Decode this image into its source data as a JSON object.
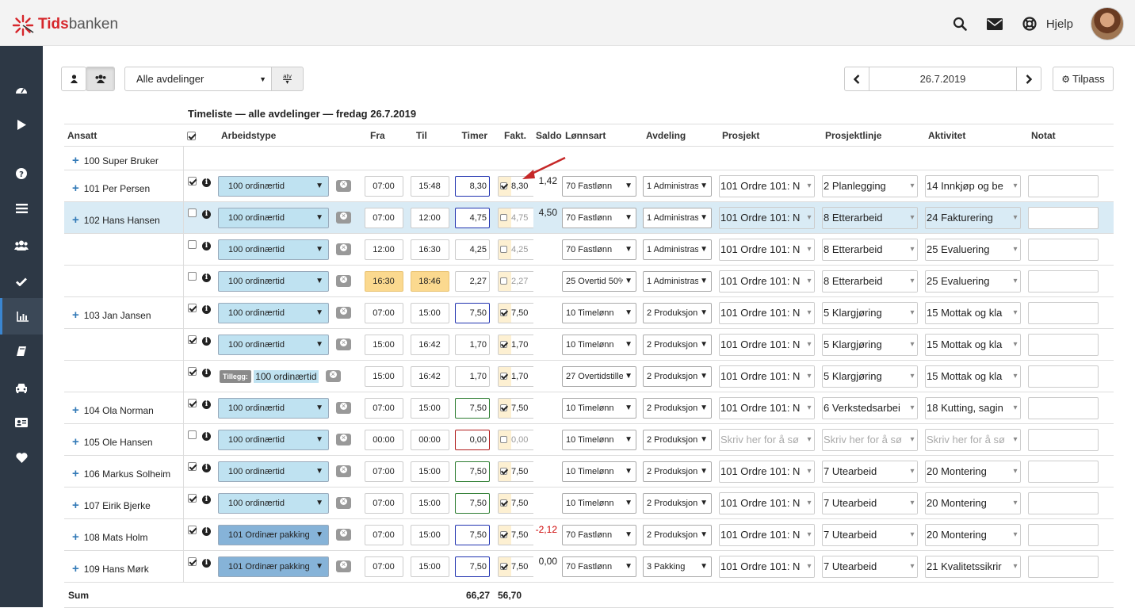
{
  "app": {
    "brand_bold": "Tids",
    "brand_rest": "banken",
    "help_label": "Hjelp"
  },
  "colors": {
    "sidebar": "#2d3845",
    "accent": "#337ab7",
    "highlight": "#bfe2f1",
    "dark_highlight": "#86b3d8",
    "brand_red": "#d6262b"
  },
  "icons": {
    "top": [
      "search-icon",
      "envelope-icon",
      "lifebuoy-icon"
    ],
    "sidebar": [
      "dashboard-icon",
      "play-icon",
      "question-icon",
      "list-icon",
      "users-icon",
      "check-icon",
      "bar-chart-icon",
      "book-icon",
      "car-icon",
      "id-card-icon",
      "heart-icon"
    ]
  },
  "toolbar": {
    "department": "Alle avdelinger",
    "atv_label": "atv",
    "date": "26.7.2019",
    "tilpass": "Tilpass"
  },
  "title": "Timeliste — alle avdelinger — fredag 26.7.2019",
  "columns": {
    "ansatt": "Ansatt",
    "arbeidstype": "Arbeidstype",
    "fra": "Fra",
    "til": "Til",
    "timer": "Timer",
    "fakt": "Fakt.",
    "saldo": "Saldo",
    "lonnsart": "Lønnsart",
    "avdeling": "Avdeling",
    "prosjekt": "Prosjekt",
    "prosjektlinje": "Prosjektlinje",
    "aktivitet": "Aktivitet",
    "notat": "Notat"
  },
  "header_check": true,
  "first_row": {
    "employee": "100 Super Bruker"
  },
  "tillegg_label": "Tillegg:",
  "rows": [
    {
      "employee": "101 Per Persen",
      "checked": true,
      "worktype": "100 ordinærtid",
      "from": "07:00",
      "to": "15:48",
      "hours": "8,30",
      "hours_border": "blue",
      "fakt_checked": true,
      "fakt": "8,30",
      "saldo": "1,42",
      "lonnsart": "70 Fastlønn",
      "avdeling": "1 Administras",
      "prosjekt": "101 Ordre 101: N",
      "prosjektlinje": "2 Planlegging",
      "aktivitet": "14 Innkjøp og be"
    },
    {
      "employee": "102 Hans Hansen",
      "selected": true,
      "checked": false,
      "worktype": "100 ordinærtid",
      "from": "07:00",
      "to": "12:00",
      "hours": "4,75",
      "hours_border": "blue",
      "fakt_checked": false,
      "fakt": "4,75",
      "saldo": "4,50",
      "lonnsart": "70 Fastlønn",
      "avdeling": "1 Administras",
      "prosjekt": "101 Ordre 101: N",
      "prosjektlinje": "8 Etterarbeid",
      "aktivitet": "24 Fakturering"
    },
    {
      "employee": "",
      "checked": false,
      "worktype": "100 ordinærtid",
      "from": "12:00",
      "to": "16:30",
      "hours": "4,25",
      "hours_border": "",
      "fakt_checked": false,
      "fakt": "4,25",
      "saldo": "",
      "lonnsart": "70 Fastlønn",
      "avdeling": "1 Administras",
      "prosjekt": "101 Ordre 101: N",
      "prosjektlinje": "8 Etterarbeid",
      "aktivitet": "25 Evaluering"
    },
    {
      "employee": "",
      "checked": false,
      "worktype": "100 ordinærtid",
      "from": "16:30",
      "to": "18:46",
      "time_highlight": true,
      "hours": "2,27",
      "hours_border": "",
      "fakt_checked": false,
      "fakt": "2,27",
      "saldo": "",
      "lonnsart": "25 Overtid 50%",
      "avdeling": "1 Administras",
      "prosjekt": "101 Ordre 101: N",
      "prosjektlinje": "8 Etterarbeid",
      "aktivitet": "25 Evaluering"
    },
    {
      "employee": "103 Jan Jansen",
      "checked": true,
      "worktype": "100 ordinærtid",
      "from": "07:00",
      "to": "15:00",
      "hours": "7,50",
      "hours_border": "blue",
      "fakt_checked": true,
      "fakt": "7,50",
      "saldo": "",
      "lonnsart": "10 Timelønn",
      "avdeling": "2 Produksjon",
      "prosjekt": "101 Ordre 101: N",
      "prosjektlinje": "5 Klargjøring",
      "aktivitet": "15 Mottak og kla"
    },
    {
      "employee": "",
      "checked": true,
      "worktype": "100 ordinærtid",
      "from": "15:00",
      "to": "16:42",
      "hours": "1,70",
      "hours_border": "",
      "fakt_checked": true,
      "fakt": "1,70",
      "saldo": "",
      "lonnsart": "10 Timelønn",
      "avdeling": "2 Produksjon",
      "prosjekt": "101 Ordre 101: N",
      "prosjektlinje": "5 Klargjøring",
      "aktivitet": "15 Mottak og kla"
    },
    {
      "employee": "",
      "checked": true,
      "tillegg": true,
      "worktype": "100 ordinærtid",
      "from": "15:00",
      "to": "16:42",
      "hours": "1,70",
      "hours_border": "",
      "fakt_checked": true,
      "fakt": "1,70",
      "saldo": "",
      "lonnsart": "27 Overtidstille",
      "avdeling": "2 Produksjon",
      "prosjekt": "101 Ordre 101: N",
      "prosjektlinje": "5 Klargjøring",
      "aktivitet": "15 Mottak og kla"
    },
    {
      "employee": "104 Ola Norman",
      "checked": true,
      "worktype": "100 ordinærtid",
      "from": "07:00",
      "to": "15:00",
      "hours": "7,50",
      "hours_border": "green",
      "fakt_checked": true,
      "fakt": "7,50",
      "saldo": "",
      "lonnsart": "10 Timelønn",
      "avdeling": "2 Produksjon",
      "prosjekt": "101 Ordre 101: N",
      "prosjektlinje": "6 Verkstedsarbei",
      "aktivitet": "18 Kutting, sagin"
    },
    {
      "employee": "105 Ole Hansen",
      "checked": false,
      "worktype": "100 ordinærtid",
      "from": "00:00",
      "to": "00:00",
      "hours": "0,00",
      "hours_border": "red",
      "fakt_checked": false,
      "fakt": "0,00",
      "saldo": "",
      "lonnsart": "10 Timelønn",
      "avdeling": "2 Produksjon",
      "prosjekt": "Skriv her for å sø",
      "prosjekt_ph": true,
      "prosjektlinje": "Skriv her for å sø",
      "prosjektlinje_ph": true,
      "aktivitet": "Skriv her for å sø",
      "aktivitet_ph": true
    },
    {
      "employee": "106 Markus Solheim",
      "checked": true,
      "worktype": "100 ordinærtid",
      "from": "07:00",
      "to": "15:00",
      "hours": "7,50",
      "hours_border": "green",
      "fakt_checked": true,
      "fakt": "7,50",
      "saldo": "",
      "lonnsart": "10 Timelønn",
      "avdeling": "2 Produksjon",
      "prosjekt": "101 Ordre 101: N",
      "prosjektlinje": "7 Utearbeid",
      "aktivitet": "20 Montering"
    },
    {
      "employee": "107 Eirik Bjerke",
      "checked": true,
      "worktype": "100 ordinærtid",
      "from": "07:00",
      "to": "15:00",
      "hours": "7,50",
      "hours_border": "green",
      "fakt_checked": true,
      "fakt": "7,50",
      "saldo": "",
      "lonnsart": "10 Timelønn",
      "avdeling": "2 Produksjon",
      "prosjekt": "101 Ordre 101: N",
      "prosjektlinje": "7 Utearbeid",
      "aktivitet": "20 Montering"
    },
    {
      "employee": "108 Mats Holm",
      "checked": true,
      "worktype": "101 Ordinær pakking",
      "worktype_dark": true,
      "from": "07:00",
      "to": "15:00",
      "hours": "7,50",
      "hours_border": "blue",
      "fakt_checked": true,
      "fakt": "7,50",
      "saldo": "-2,12",
      "saldo_negative": true,
      "lonnsart": "70 Fastlønn",
      "avdeling": "2 Produksjon",
      "prosjekt": "101 Ordre 101: N",
      "prosjektlinje": "7 Utearbeid",
      "aktivitet": "20 Montering"
    },
    {
      "employee": "109 Hans Mørk",
      "checked": true,
      "worktype": "101 Ordinær pakking",
      "worktype_dark": true,
      "from": "07:00",
      "to": "15:00",
      "hours": "7,50",
      "hours_border": "blue",
      "fakt_checked": true,
      "fakt": "7,50",
      "saldo": "0,00",
      "lonnsart": "70 Fastlønn",
      "avdeling": "3 Pakking",
      "prosjekt": "101 Ordre 101: N",
      "prosjektlinje": "7 Utearbeid",
      "aktivitet": "21 Kvalitetssikrir"
    }
  ],
  "sum": {
    "label": "Sum",
    "timer": "66,27",
    "fakt": "56,70"
  }
}
